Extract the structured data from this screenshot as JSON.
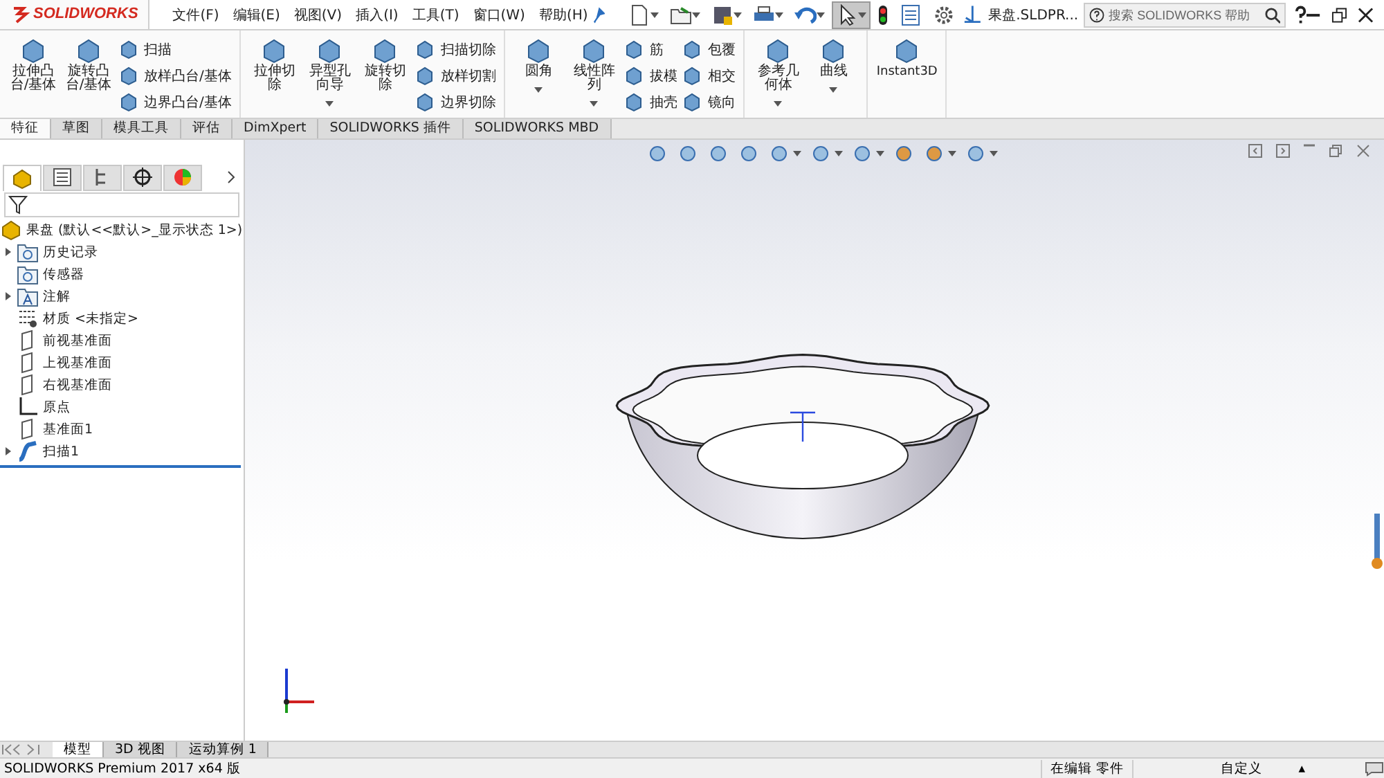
{
  "logo": {
    "text": "SOLIDWORKS"
  },
  "menu": [
    "文件(F)",
    "编辑(E)",
    "视图(V)",
    "插入(I)",
    "工具(T)",
    "窗口(W)",
    "帮助(H)"
  ],
  "quick_tools": [
    {
      "kind": "new",
      "selected": false
    },
    {
      "kind": "open",
      "selected": false
    },
    {
      "kind": "save",
      "selected": false
    },
    {
      "kind": "print",
      "selected": false
    },
    {
      "kind": "undo",
      "selected": false
    },
    {
      "kind": "select",
      "selected": true
    },
    {
      "kind": "light",
      "selected": false
    },
    {
      "kind": "list",
      "selected": false
    },
    {
      "kind": "gear",
      "selected": false
    }
  ],
  "document_title": "果盘.SLDPR...",
  "search": {
    "placeholder": "搜索 SOLIDWORKS 帮助"
  },
  "ribbon": [
    {
      "items": [
        {
          "kind": "large",
          "label": "拉伸凸台/基体",
          "dropdown": false
        },
        {
          "kind": "large",
          "label": "旋转凸台/基体",
          "dropdown": false
        },
        {
          "kind": "small",
          "labels": [
            "扫描",
            "放样凸台/基体",
            "边界凸台/基体"
          ]
        }
      ]
    },
    {
      "items": [
        {
          "kind": "large",
          "label": "拉伸切除",
          "dropdown": false
        },
        {
          "kind": "large",
          "label": "异型孔向导",
          "dropdown": true
        },
        {
          "kind": "large",
          "label": "旋转切除",
          "dropdown": false
        },
        {
          "kind": "small",
          "labels": [
            "扫描切除",
            "放样切割",
            "边界切除"
          ]
        }
      ]
    },
    {
      "items": [
        {
          "kind": "large",
          "label": "圆角",
          "dropdown": true
        },
        {
          "kind": "large",
          "label": "线性阵列",
          "dropdown": true
        },
        {
          "kind": "small",
          "labels": [
            "筋",
            "拔模",
            "抽壳"
          ]
        },
        {
          "kind": "small",
          "labels": [
            "包覆",
            "相交",
            "镜向"
          ]
        }
      ]
    },
    {
      "items": [
        {
          "kind": "large",
          "label": "参考几何体",
          "dropdown": true
        },
        {
          "kind": "large",
          "label": "曲线",
          "dropdown": true
        }
      ]
    },
    {
      "items": [
        {
          "kind": "wide",
          "label": "Instant3D"
        }
      ]
    }
  ],
  "command_tabs": [
    {
      "label": "特征",
      "selected": true
    },
    {
      "label": "草图",
      "selected": false
    },
    {
      "label": "模具工具",
      "selected": false
    },
    {
      "label": "评估",
      "selected": false
    },
    {
      "label": "DimXpert",
      "selected": false
    },
    {
      "label": "SOLIDWORKS 插件",
      "selected": false
    },
    {
      "label": "SOLIDWORKS MBD",
      "selected": false
    }
  ],
  "panel_tabs": [
    {
      "kind": "part",
      "selected": true
    },
    {
      "kind": "list",
      "selected": false
    },
    {
      "kind": "tree",
      "selected": false
    },
    {
      "kind": "crosshair",
      "selected": false
    },
    {
      "kind": "wheel",
      "selected": false
    }
  ],
  "feature_tree": {
    "root": "果盘  (默认<<默认>_显示状态 1>)",
    "items": [
      {
        "kind": "history",
        "label": "历史记录",
        "expanded": false
      },
      {
        "kind": "sensor",
        "label": "传感器"
      },
      {
        "kind": "annotation",
        "label": "注解",
        "expanded": false
      },
      {
        "kind": "material",
        "label": "材质 <未指定>"
      },
      {
        "kind": "plane",
        "label": "前视基准面"
      },
      {
        "kind": "plane",
        "label": "上视基准面"
      },
      {
        "kind": "plane",
        "label": "右视基准面"
      },
      {
        "kind": "origin",
        "label": "原点"
      },
      {
        "kind": "plane",
        "label": "基准面1"
      },
      {
        "kind": "sweep",
        "label": "扫描1",
        "expanded": false
      }
    ]
  },
  "model_tabs": [
    {
      "label": "模型",
      "selected": true
    },
    {
      "label": "3D 视图",
      "selected": false
    },
    {
      "label": "运动算例 1",
      "selected": false
    }
  ],
  "status_bar": {
    "product": "SOLIDWORKS Premium 2017 x64 版",
    "mode": "在编辑 零件",
    "units": "自定义",
    "units_caret": "▴"
  }
}
